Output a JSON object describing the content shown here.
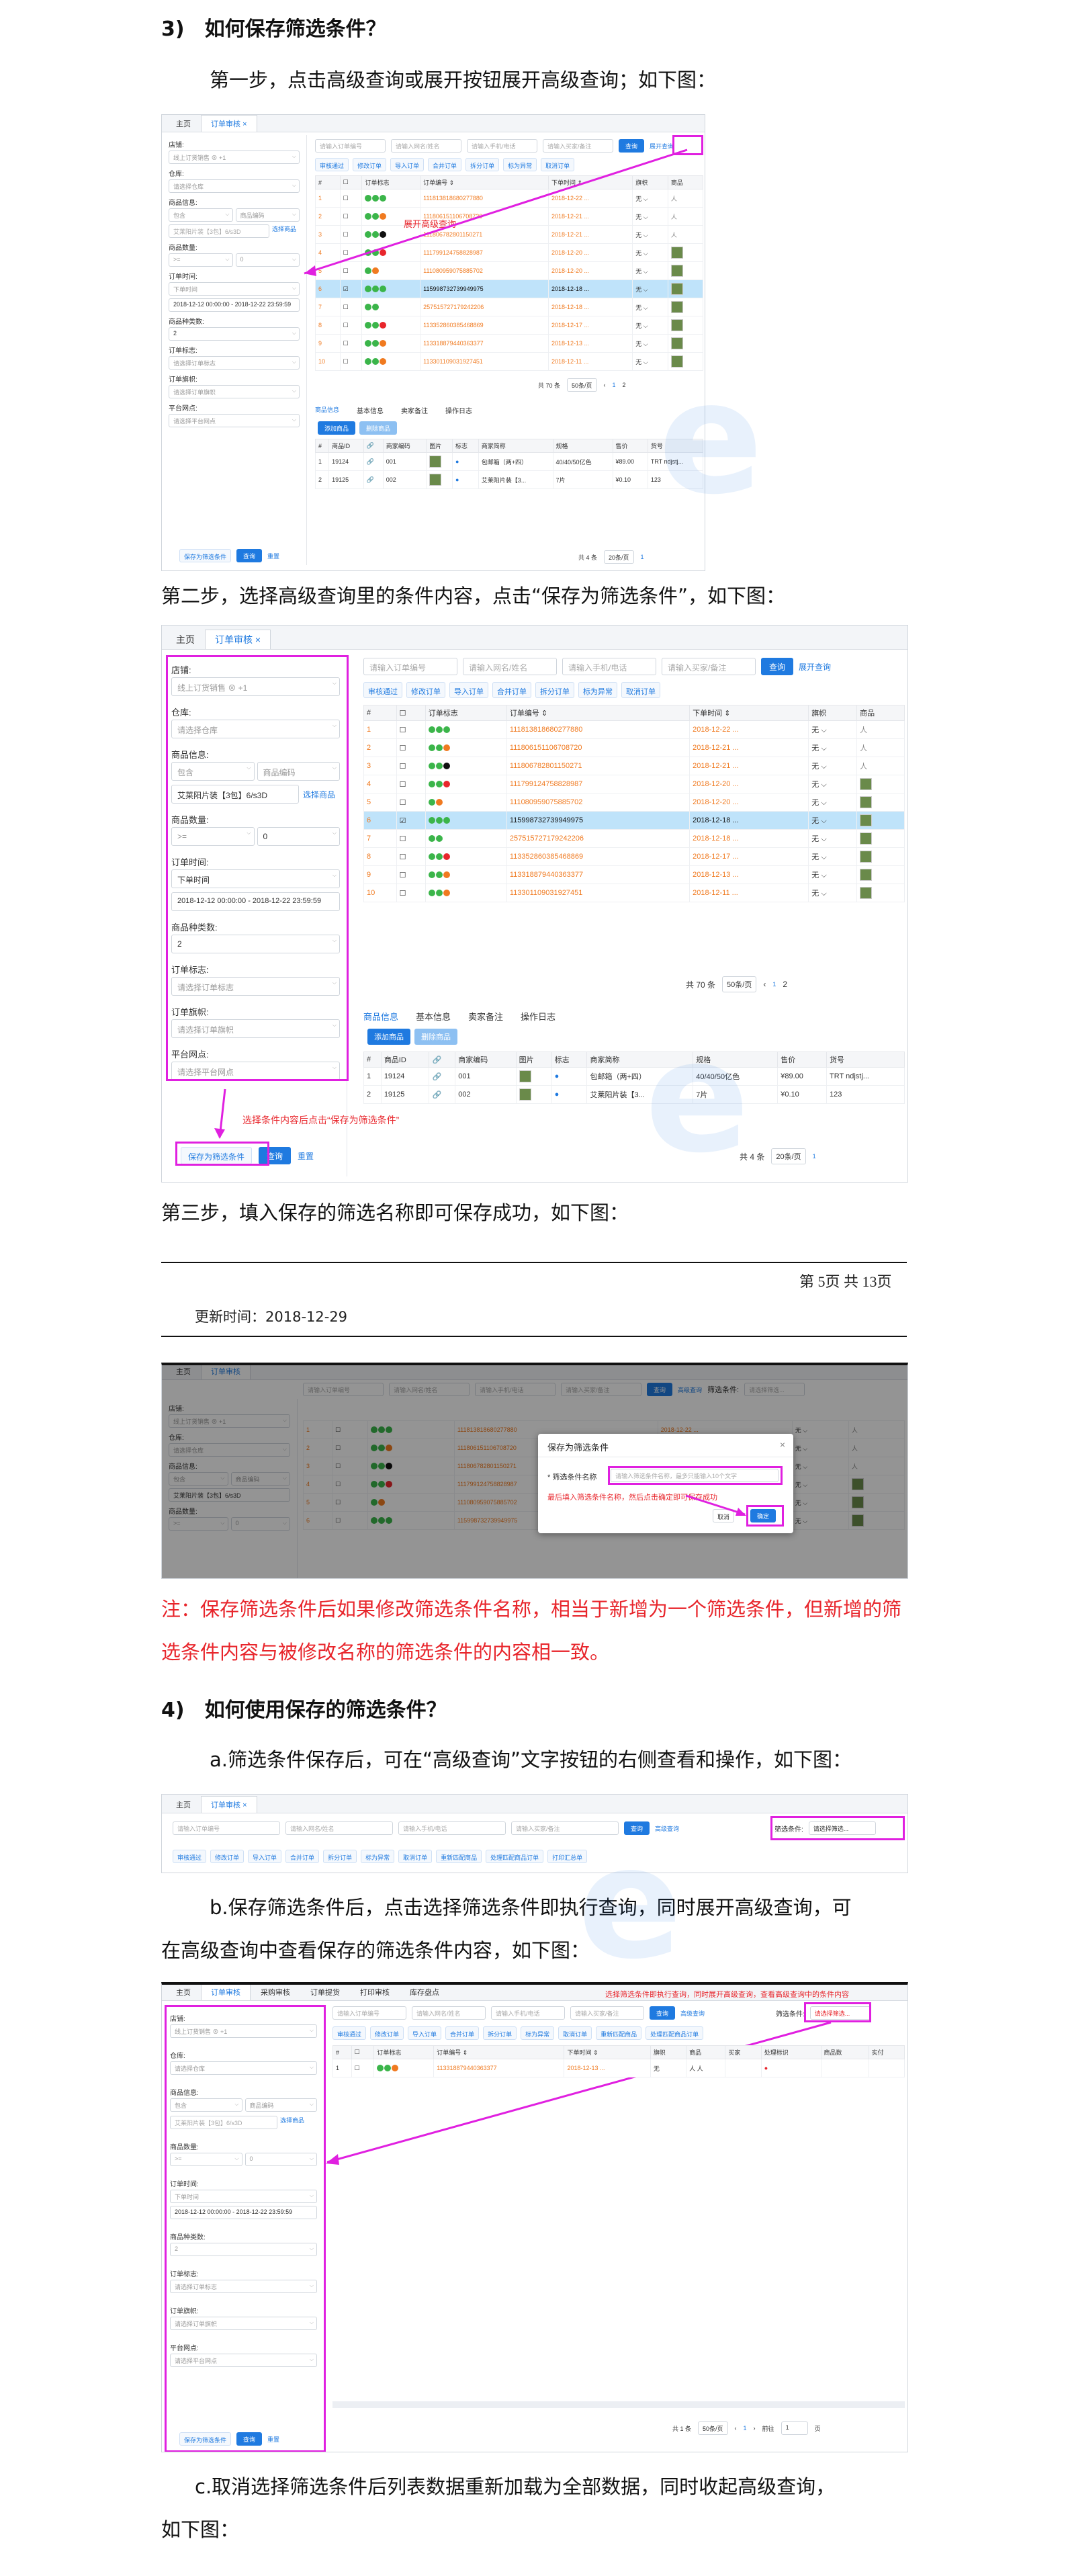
{
  "sec3": {
    "heading": "3)　如何保存筛选条件？"
  },
  "step1": "第一步，点击高级查询或展开按钮展开高级查询；如下图：",
  "step2": "第二步，选择高级查询里的条件内容，点击“保存为筛选条件”，如下图：",
  "step3": "第三步，填入保存的筛选名称即可保存成功，如下图：",
  "footer": {
    "page": "第 5页  共 13页",
    "updated": "更新时间：2018-12-29"
  },
  "note_line1": "注：保存筛选条件后如果修改筛选条件名称，相当于新增为一个筛选条件，但新增的筛",
  "note_line2": "选条件内容与被修改名称的筛选条件的内容相一致。",
  "sec4": {
    "heading": "4)　如何使用保存的筛选条件？"
  },
  "para_a": "a.筛选条件保存后，可在“高级查询”文字按钮的右侧查看和操作，如下图：",
  "para_b1": "b.保存筛选条件后，点击选择筛选条件即执行查询，同时展开高级查询，可",
  "para_b2": "在高级查询中查看保存的筛选条件内容，如下图：",
  "para_c1": "c.取消选择筛选条件后列表数据重新加载为全部数据，同时收起高级查询，",
  "para_c2": "如下图：",
  "app": {
    "tabs": [
      "主页",
      "订单审核"
    ],
    "tabs_b": [
      "主页",
      "订单审核",
      "采购审核",
      "订单提货",
      "打印审核",
      "库存盘点"
    ],
    "filters": {
      "shop_label": "店铺:",
      "shop_value": "线上订货销售 ⊗  +1",
      "warehouse_label": "仓库:",
      "warehouse_ph": "请选择仓库",
      "goods_label": "商品信息:",
      "goods_a": "包含",
      "goods_b": "商品编码",
      "goods_value": "艾莱阳片装【3包】6/s3D",
      "goods_link": "选择商品",
      "qty_label": "商品数量:",
      "qty_a": ">=",
      "qty_b": "0",
      "time_label": "订单时间:",
      "time_a": "下单时间",
      "time_range": "2018-12-12 00:00:00 - 2018-12-22 23:59:59",
      "kinds_label": "商品种类数:",
      "kinds_value": "2",
      "tag_label": "订单标志:",
      "tag_ph": "请选择订单标志",
      "flag_label": "订单旗帜:",
      "flag_ph": "请选择订单旗帜",
      "platform_label": "平台网点:",
      "platform_ph": "请选择平台网点",
      "save_btn": "保存为筛选条件",
      "query_btn": "查询",
      "reset": "重置"
    },
    "search": {
      "order_ph": "请输入订单编号",
      "buyer_ph": "请输入网名/姓名",
      "phone_ph": "请输入手机/电话",
      "remark_ph": "请输入买家/备注",
      "query": "查询",
      "advanced": "高级查询",
      "expand": "展开查询",
      "filter_label": "筛选条件:",
      "filter_ph": "请选择筛选..."
    },
    "toolbar": [
      "审核通过",
      "修改订单",
      "导入订单",
      "合并订单",
      "拆分订单",
      "标为异常",
      "取消订单",
      "重新匹配商品",
      "处理匹配商品订单",
      "打印汇总单"
    ],
    "columns": [
      "#",
      "订单标志",
      "订单编号 ⇕",
      "下单时间 ⇕",
      "旗帜",
      "商品"
    ],
    "orders": [
      {
        "n": "1",
        "no": "111813818680277880",
        "t": "2018-12-22 ..."
      },
      {
        "n": "2",
        "no": "111806151106708720",
        "t": "2018-12-21 ..."
      },
      {
        "n": "3",
        "no": "111806782801150271",
        "t": "2018-12-21 ..."
      },
      {
        "n": "4",
        "no": "111799124758828987",
        "t": "2018-12-20 ..."
      },
      {
        "n": "5",
        "no": "111080959075885702",
        "t": "2018-12-20 ..."
      },
      {
        "n": "6",
        "no": "115998732739949975",
        "t": "2018-12-18 ..."
      },
      {
        "n": "7",
        "no": "257515727179242206",
        "t": "2018-12-18 ..."
      },
      {
        "n": "8",
        "no": "113352860385468869",
        "t": "2018-12-17 ..."
      },
      {
        "n": "9",
        "no": "113318879440363377",
        "t": "2018-12-13 ..."
      },
      {
        "n": "10",
        "no": "113301109031927451",
        "t": "2018-12-11 ..."
      }
    ],
    "flag_none": "无",
    "total": "共 70 条",
    "pagesize": "50条/页",
    "page1": "1",
    "page2": "2",
    "bottom_tabs": [
      "商品信息",
      "基本信息",
      "卖家备注",
      "操作日志"
    ],
    "sub_btns": [
      "添加商品",
      "删除商品"
    ],
    "sub_cols": [
      "#",
      "商品ID",
      "🔗",
      "商家编码",
      "图片",
      "标志",
      "商家简称",
      "规格",
      "售价",
      "货号"
    ],
    "sub_rows": [
      {
        "n": "1",
        "id": "19124",
        "code": "001",
        "name": "包邮箱（两+四）",
        "spec": "40/40/50亿色",
        "price": "¥89.00",
        "sku": "TRT ndjstj..."
      },
      {
        "n": "2",
        "id": "19125",
        "code": "002",
        "name": "艾莱阳片装【3...",
        "spec": "7片",
        "price": "¥0.10",
        "sku": "123"
      }
    ],
    "sub_total": "共 4 条",
    "sub_pagesize": "20条/页",
    "ann_expand": "展开高级查询",
    "ann_save": "选择条件内容后点击“保存为筛选条件”",
    "dialog": {
      "title": "保存为筛选条件",
      "label": "* 筛选条件名称",
      "ph": "请输入筛选条件名称，最多只能输入10个文字",
      "hint": "最后填入筛选条件名称，然后点击确定即可保存成功",
      "cancel": "取消",
      "ok": "确定"
    },
    "ann_b": "选择筛选条件即执行查询，同时展开高级查询，查看高级查询中的条件内容",
    "b_order": {
      "n": "1",
      "no": "113318879440363377",
      "t": "2018-12-13 ..."
    },
    "b_total": "共 1 条",
    "b_pagesize": "50条/页",
    "b_goto": "前往",
    "b_page": "1",
    "b_page_suffix": "页",
    "extra_cols": [
      "买家",
      "处理标识",
      "商品数",
      "实付"
    ]
  }
}
